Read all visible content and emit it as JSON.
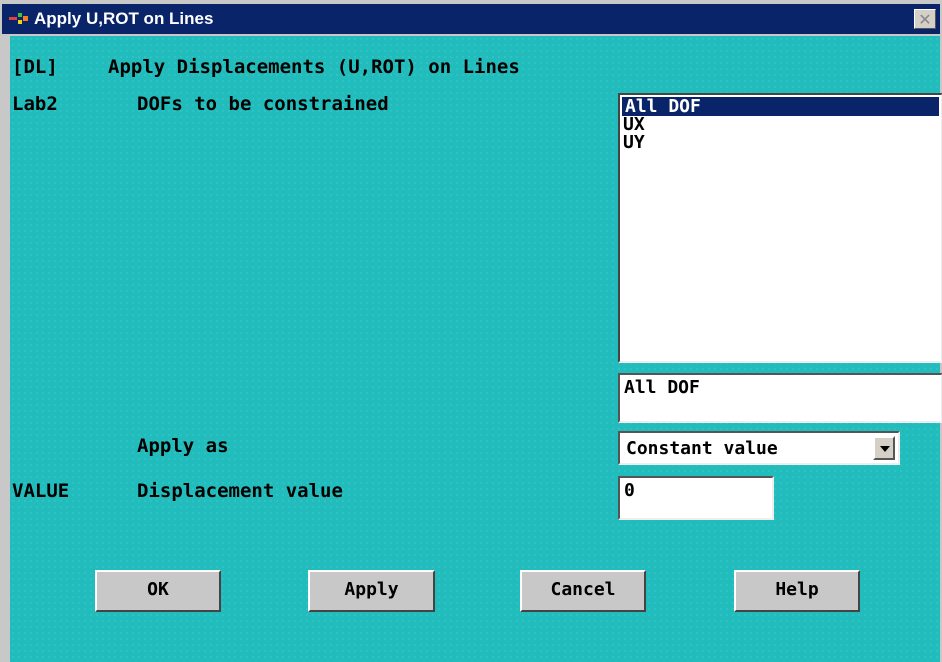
{
  "window": {
    "title": "Apply U,ROT on Lines",
    "close_glyph": "✕",
    "icon": "ansys-app-icon"
  },
  "header": {
    "code": "[DL]",
    "description": "Apply Displacements (U,ROT) on Lines"
  },
  "lab2": {
    "code": "Lab2",
    "label": "DOFs to be constrained",
    "options": [
      "All DOF",
      "UX",
      "UY"
    ],
    "selected_index": 0,
    "selection_text": "All DOF"
  },
  "apply_as": {
    "label": "Apply as",
    "selected": "Constant value"
  },
  "value": {
    "code": "VALUE",
    "label": "Displacement value",
    "input": "0"
  },
  "buttons": {
    "ok": "OK",
    "apply": "Apply",
    "cancel": "Cancel",
    "help": "Help"
  },
  "colors": {
    "background": "#22bcbc",
    "title_bar": "#0a246a",
    "selection": "#0a246a"
  }
}
